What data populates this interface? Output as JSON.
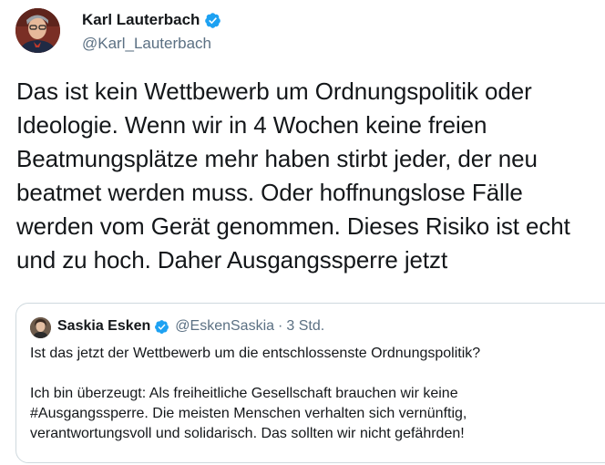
{
  "tweet": {
    "author": {
      "display_name": "Karl Lauterbach",
      "handle": "@Karl_Lauterbach",
      "verified": true
    },
    "text_lines": [
      "Das ist kein Wettbewerb um Ordnungspolitik oder",
      "Ideologie. Wenn wir in 4 Wochen keine freien",
      "Beatmungsplätze mehr haben stirbt jeder, der neu",
      "beatmet werden muss. Oder hoffnungslose Fälle",
      "werden vom Gerät genommen. Dieses Risiko ist echt",
      "und zu hoch. Daher Ausgangssperre jetzt"
    ]
  },
  "quoted_tweet": {
    "author": {
      "display_name": "Saskia Esken",
      "handle": "@EskenSaskia",
      "verified": true
    },
    "separator": "·",
    "time": "3 Std.",
    "paragraph1_lines": [
      "Ist das jetzt der Wettbewerb um die entschlossenste Ordnungspolitik?"
    ],
    "paragraph2_lines": [
      "Ich bin überzeugt: Als freiheitliche Gesellschaft brauchen wir keine",
      "#Ausgangssperre. Die meisten Menschen verhalten sich vernünftig,",
      "verantwortungsvoll und solidarisch. Das sollten wir nicht gefährden!"
    ]
  },
  "colors": {
    "verified_badge": "#1da1f2",
    "text_primary": "#14171a",
    "text_secondary": "#5b7083",
    "border": "#cfd9de"
  }
}
